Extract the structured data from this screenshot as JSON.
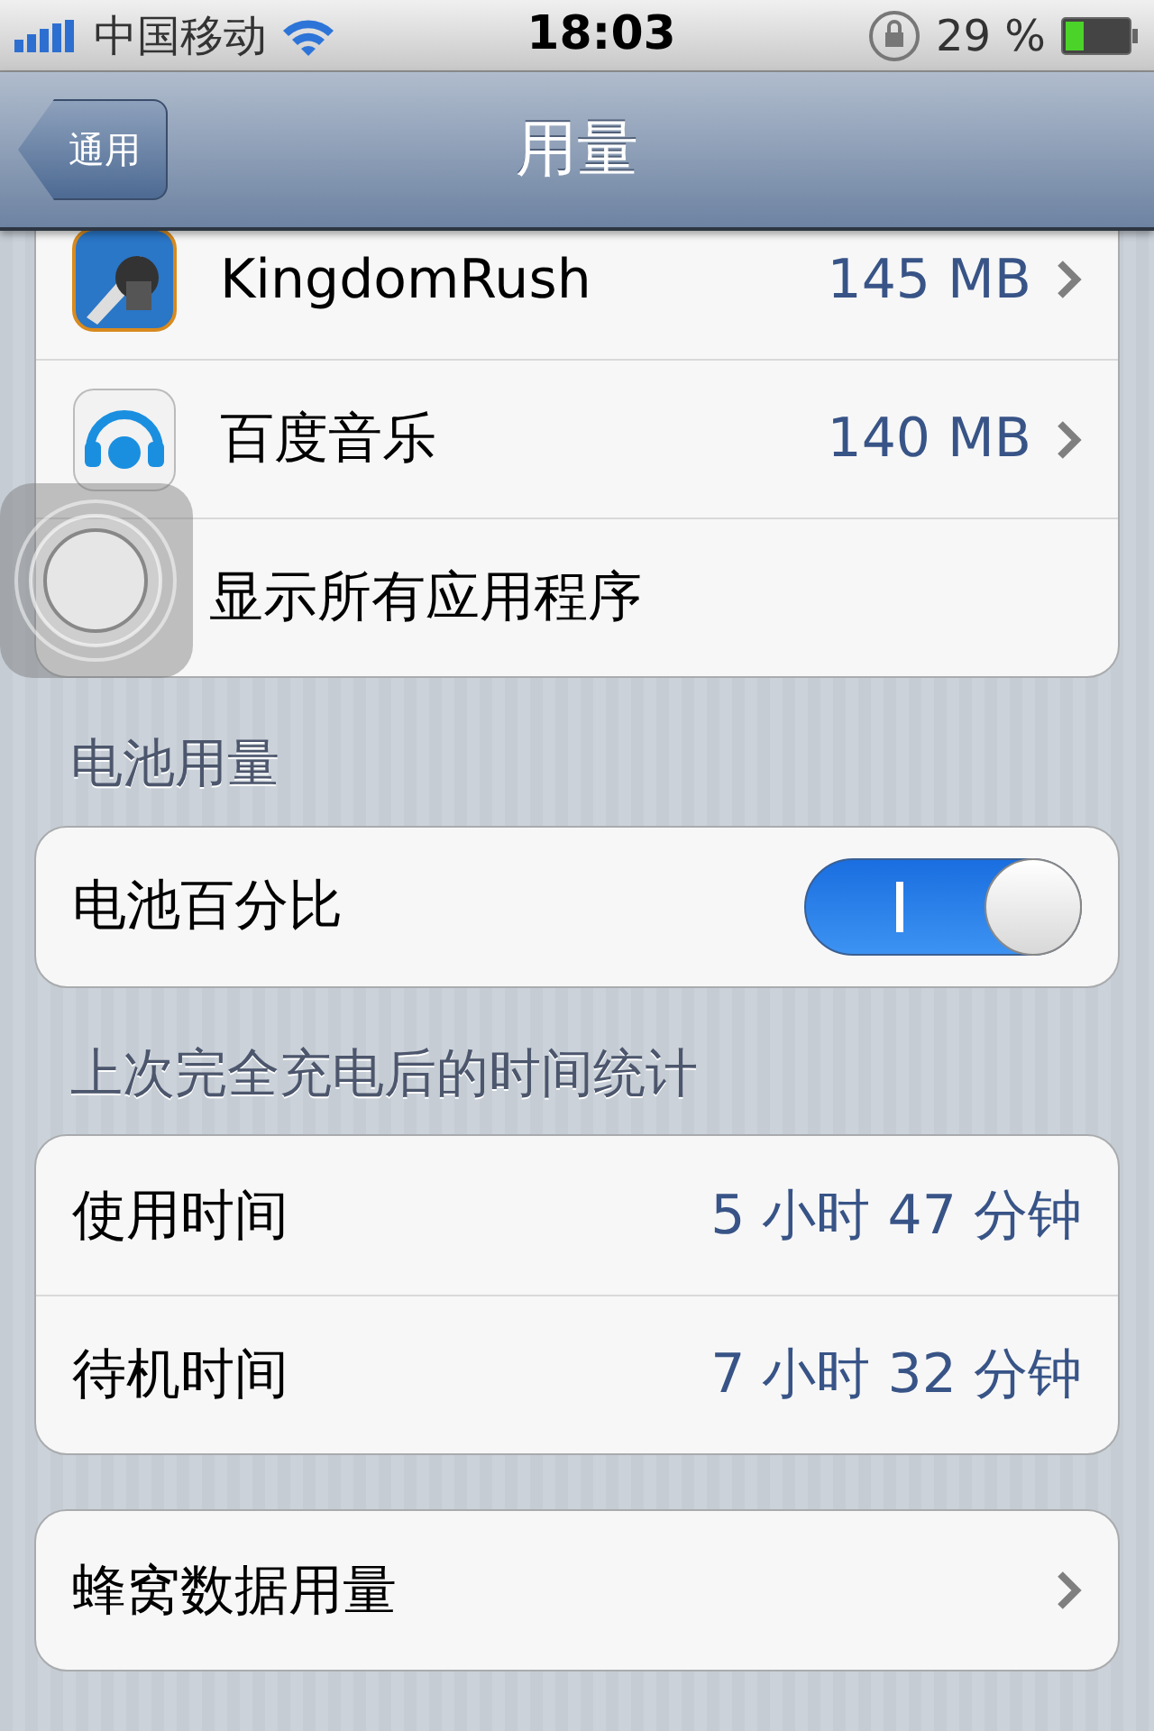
{
  "status_bar": {
    "carrier": "中国移动",
    "time": "18:03",
    "battery": "29 %"
  },
  "nav": {
    "back": "通用",
    "title": "用量"
  },
  "sections": [
    {
      "rows": [
        {
          "kind": "app",
          "label": "KingdomRush",
          "value": "145 MB"
        },
        {
          "kind": "app",
          "label": "百度音乐",
          "value": "140 MB"
        },
        {
          "kind": "action",
          "label": "显示所有应用程序"
        }
      ]
    },
    {
      "header": "电池用量",
      "rows": [
        {
          "kind": "toggle",
          "label": "电池百分比",
          "on": true
        }
      ]
    },
    {
      "header": "上次完全充电后的时间统计",
      "rows": [
        {
          "kind": "info",
          "label": "使用时间",
          "value": "5 小时 47 分钟"
        },
        {
          "kind": "info",
          "label": "待机时间",
          "value": "7 小时 32 分钟"
        }
      ]
    },
    {
      "rows": [
        {
          "kind": "link",
          "label": "蜂窝数据用量"
        }
      ]
    }
  ]
}
